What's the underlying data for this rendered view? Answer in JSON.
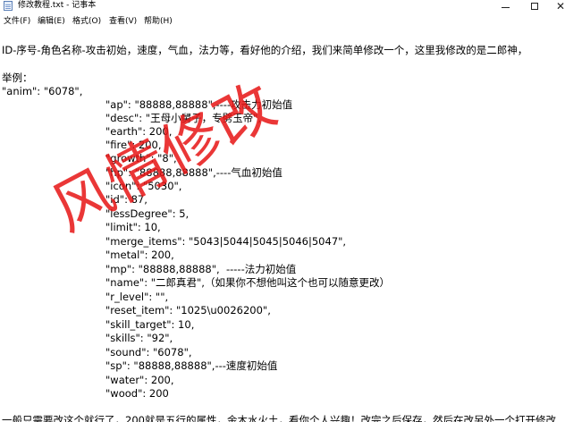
{
  "window": {
    "title": "修改教程.txt - 记事本",
    "close_glyph": "✕"
  },
  "menu": [
    "文件(F)",
    "编辑(E)",
    "格式(O)",
    "查看(V)",
    "帮助(H)"
  ],
  "content": {
    "intro": "ID-序号-角色名称-攻击初始，速度，气血，法力等，看好他的介绍，我们来简单修改一个，这里我修改的是二郎神，",
    "example_heading": "举例：",
    "anim_line": "\"anim\": \"6078\",",
    "fields": [
      "\"ap\": \"88888,88888\",----攻击力初始值",
      "\"desc\": \"王母小舅子，专劈玉帝\",",
      "\"earth\": 200,",
      "\"fire\": 200,",
      "\"growth\": \"8\",",
      "\"hp\": \"88888,88888\",----气血初始值",
      "\"icon\": \"5030\",",
      "\"id\": 87,",
      "\"lessDegree\": 5,",
      "\"limit\": 10,",
      "\"merge_items\": \"5043|5044|5045|5046|5047\",",
      "\"metal\": 200,",
      "\"mp\": \"88888,88888\",  -----法力初始值",
      "\"name\": \"二郎真君\",（如果你不想他叫这个也可以随意更改）",
      "\"r_level\": \"\",",
      "\"reset_item\": \"1025\\u0026200\",",
      "\"skill_target\": 10,",
      "\"skills\": \"92\",",
      "\"sound\": \"6078\",",
      "\"sp\": \"88888,88888\",---速度初始值",
      "\"water\": 200,",
      "\"wood\": 200"
    ],
    "footer": "一般只需要改这个就行了，200就是五行的属性，金木水火土，看你个人兴趣！改完之后保存，然后在改另外一个打开修改"
  },
  "watermark": "风情修改"
}
